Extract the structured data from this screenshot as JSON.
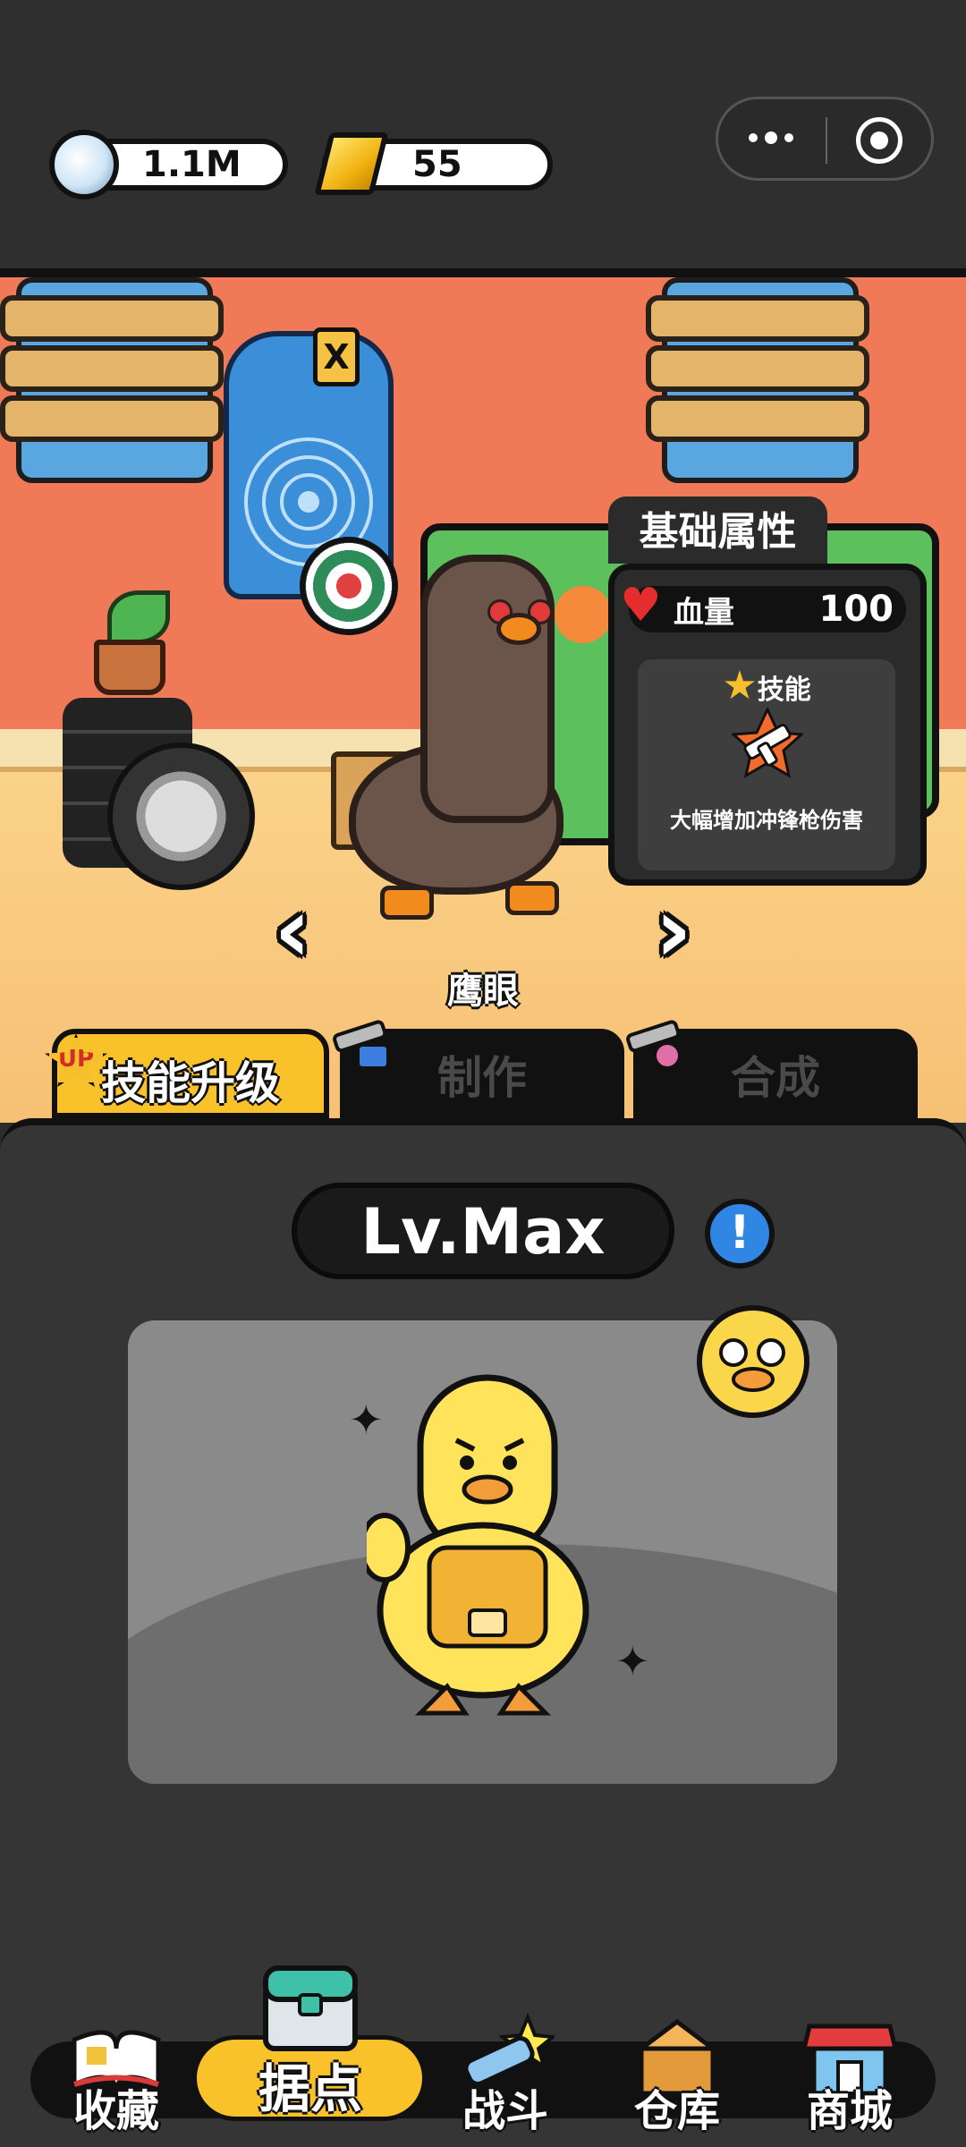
{
  "currency": {
    "silver": "1.1M",
    "gold": "55"
  },
  "scene": {
    "target_tag": "X",
    "character_name": "鹰眼",
    "prev_icon": "chevron-left-icon",
    "next_icon": "chevron-right-icon"
  },
  "stats": {
    "title": "基础属性",
    "hp_label": "血量",
    "hp_value": "100",
    "skill_label": "技能",
    "skill_desc": "大幅增加冲锋枪伤害"
  },
  "tabs": [
    {
      "label": "技能升级",
      "badge": "UP"
    },
    {
      "label": "制作"
    },
    {
      "label": "合成"
    }
  ],
  "level": {
    "text": "Lv.Max",
    "info": "!"
  },
  "nav": [
    {
      "label": "收藏",
      "icon": "book-icon"
    },
    {
      "label": "据点",
      "icon": "chest-icon"
    },
    {
      "label": "战斗",
      "icon": "gun-icon"
    },
    {
      "label": "仓库",
      "icon": "box-icon"
    },
    {
      "label": "商城",
      "icon": "shop-icon"
    }
  ],
  "colors": {
    "accent": "#f9c22a",
    "wall": "#f07a58",
    "panel": "#353535",
    "info": "#2f86e3"
  }
}
